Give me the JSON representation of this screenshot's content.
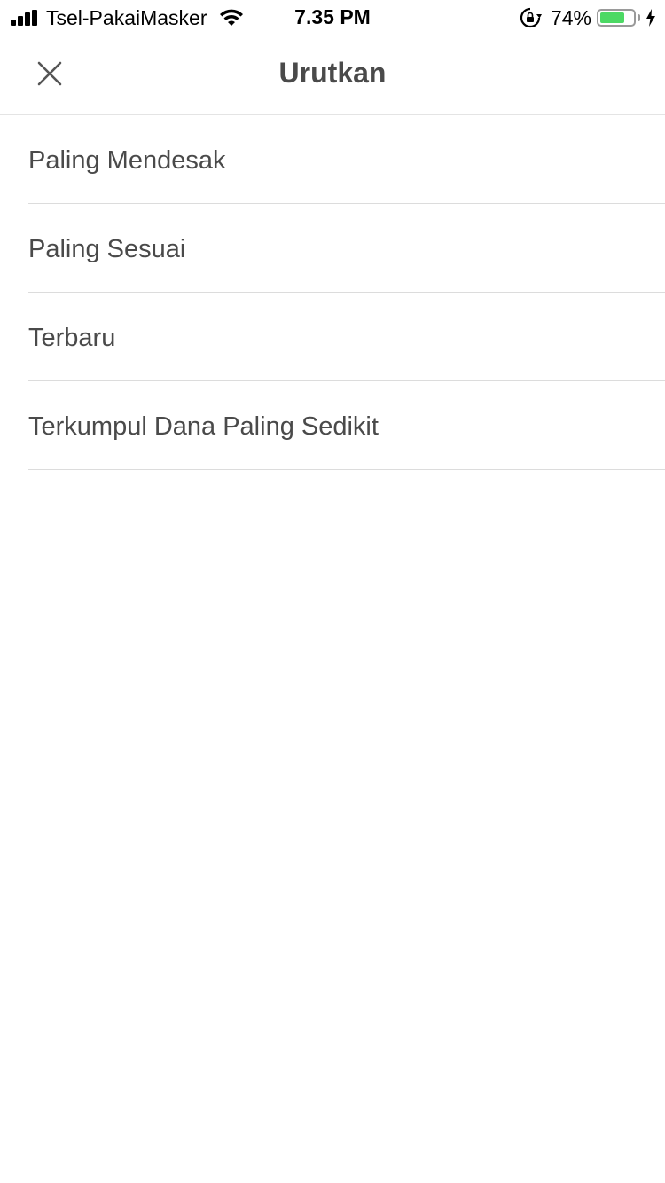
{
  "status_bar": {
    "carrier": "Tsel-PakaiMasker",
    "time": "7.35 PM",
    "battery_percent": "74%",
    "battery_level": 0.74,
    "battery_color": "#4cd964",
    "icons": [
      "signal-icon",
      "wifi-icon",
      "rotation-lock-icon",
      "battery-icon",
      "charging-bolt-icon"
    ]
  },
  "header": {
    "title": "Urutkan",
    "close_icon": "close-icon"
  },
  "sort_options": [
    {
      "label": "Paling Mendesak"
    },
    {
      "label": "Paling Sesuai"
    },
    {
      "label": "Terbaru"
    },
    {
      "label": "Terkumpul Dana Paling Sedikit"
    }
  ]
}
